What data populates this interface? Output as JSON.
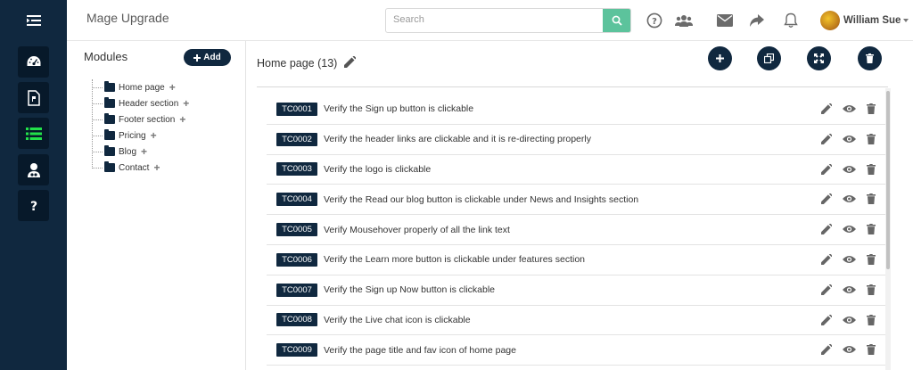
{
  "app": {
    "title": "Mage Upgrade"
  },
  "search": {
    "placeholder": "Search"
  },
  "user": {
    "name": "William Sue"
  },
  "colors": {
    "sidebar": "#10283f",
    "sidebar_button": "#07192a",
    "accent_green": "#22e14a",
    "search_button": "#5cc39c"
  },
  "sidebar": {
    "items": [
      {
        "icon": "dashboard-icon"
      },
      {
        "icon": "document-icon"
      },
      {
        "icon": "list-icon",
        "active": true
      },
      {
        "icon": "user-icon"
      },
      {
        "icon": "help-icon"
      }
    ]
  },
  "modules": {
    "title": "Modules",
    "add_label": "Add",
    "items": [
      {
        "label": "Home page"
      },
      {
        "label": "Header section"
      },
      {
        "label": "Footer section"
      },
      {
        "label": "Pricing"
      },
      {
        "label": "Blog"
      },
      {
        "label": "Contact"
      }
    ]
  },
  "main": {
    "title": "Home page (13)",
    "testcases": [
      {
        "id": "TC0001",
        "text": "Verify the Sign up button is clickable"
      },
      {
        "id": "TC0002",
        "text": "Verify the header links are clickable and it is re-directing properly"
      },
      {
        "id": "TC0003",
        "text": "Verify the logo is clickable"
      },
      {
        "id": "TC0004",
        "text": "Verify the Read our blog button is clickable under News and Insights section"
      },
      {
        "id": "TC0005",
        "text": "Verify Mousehover properly of all the link text"
      },
      {
        "id": "TC0006",
        "text": "Verify the Learn more button is clickable under features section"
      },
      {
        "id": "TC0007",
        "text": "Verify the Sign up Now button is clickable"
      },
      {
        "id": "TC0008",
        "text": "Verify the Live chat icon is clickable"
      },
      {
        "id": "TC0009",
        "text": "Verify the page title and fav icon of home page"
      }
    ]
  }
}
